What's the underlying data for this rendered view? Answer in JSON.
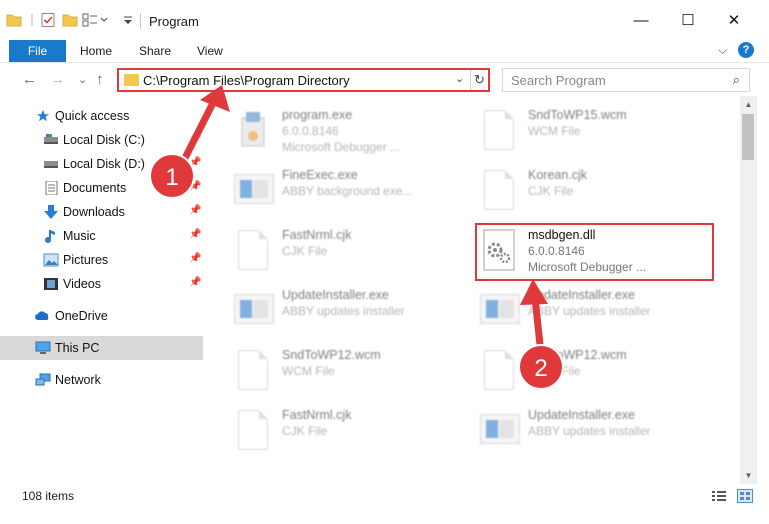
{
  "window": {
    "title": "Program",
    "controls": {
      "minimize": "—",
      "maximize": "☐",
      "close": "✕"
    }
  },
  "ribbon": {
    "tabs": [
      "File",
      "Home",
      "Share",
      "View"
    ],
    "collapse_glyph": "⌵",
    "help_glyph": "?"
  },
  "nav": {
    "back": "←",
    "forward": "→",
    "recent": "⌄",
    "up": "↑",
    "address": "C:\\Program Files\\Program Directory",
    "address_dropdown": "⌄",
    "refresh": "↻",
    "search_placeholder": "Search Program",
    "search_glyph": "⌕"
  },
  "sidebar": {
    "items": [
      {
        "label": "Quick access",
        "icon": "star-icon",
        "pinned": false
      },
      {
        "label": "Local Disk (C:)",
        "icon": "drive-icon",
        "pinned": true
      },
      {
        "label": "Local Disk (D:)",
        "icon": "drive-icon",
        "pinned": true
      },
      {
        "label": "Documents",
        "icon": "documents-icon",
        "pinned": true
      },
      {
        "label": "Downloads",
        "icon": "download-icon",
        "pinned": true
      },
      {
        "label": "Music",
        "icon": "music-icon",
        "pinned": true
      },
      {
        "label": "Pictures",
        "icon": "pictures-icon",
        "pinned": true
      },
      {
        "label": "Videos",
        "icon": "videos-icon",
        "pinned": true
      },
      {
        "label": "OneDrive",
        "icon": "cloud-icon",
        "pinned": false
      },
      {
        "label": "This PC",
        "icon": "computer-icon",
        "pinned": false,
        "selected": true
      },
      {
        "label": "Network",
        "icon": "network-icon",
        "pinned": false
      }
    ],
    "pin_glyph": "📌"
  },
  "files": [
    {
      "name": "program.exe",
      "line2": "6.0.0.8146",
      "line3": "Microsoft Debugger ...",
      "icon": "installer-icon"
    },
    {
      "name": "SndToWP15.wcm",
      "line2": "WCM File",
      "line3": "",
      "icon": "document-icon"
    },
    {
      "name": "FineExec.exe",
      "line2": "ABBY background exe...",
      "line3": "",
      "icon": "app-icon"
    },
    {
      "name": "Korean.cjk",
      "line2": "CJK File",
      "line3": "",
      "icon": "document-icon"
    },
    {
      "name": "FastNrml.cjk",
      "line2": "CJK File",
      "line3": "",
      "icon": "document-icon"
    },
    {
      "name": "msdbgen.dll",
      "line2": "6.0.0.8146",
      "line3": "Microsoft Debugger ...",
      "icon": "dll-gear-icon",
      "highlighted": true
    },
    {
      "name": "UpdateInstaller.exe",
      "line2": "ABBY updates installer",
      "line3": "",
      "icon": "app-icon"
    },
    {
      "name": "UpdateInstaller.exe",
      "line2": "ABBY updates installer",
      "line3": "",
      "icon": "app-icon"
    },
    {
      "name": "SndToWP12.wcm",
      "line2": "WCM File",
      "line3": "",
      "icon": "document-icon"
    },
    {
      "name": "SndToWP12.wcm",
      "line2": "WCM File",
      "line3": "",
      "icon": "document-icon"
    },
    {
      "name": "FastNrml.cjk",
      "line2": "CJK File",
      "line3": "",
      "icon": "document-icon"
    },
    {
      "name": "UpdateInstaller.exe",
      "line2": "ABBY updates installer",
      "line3": "",
      "icon": "app-icon"
    }
  ],
  "scrollbar": {
    "up": "▲",
    "down": "▼"
  },
  "status": {
    "item_count": "108 items"
  },
  "annotations": {
    "step1": "1",
    "step2": "2",
    "color": "#e0393b"
  },
  "colors": {
    "accent": "#1979ca",
    "folder": "#f2c94c",
    "selection": "#d9d9d9"
  }
}
